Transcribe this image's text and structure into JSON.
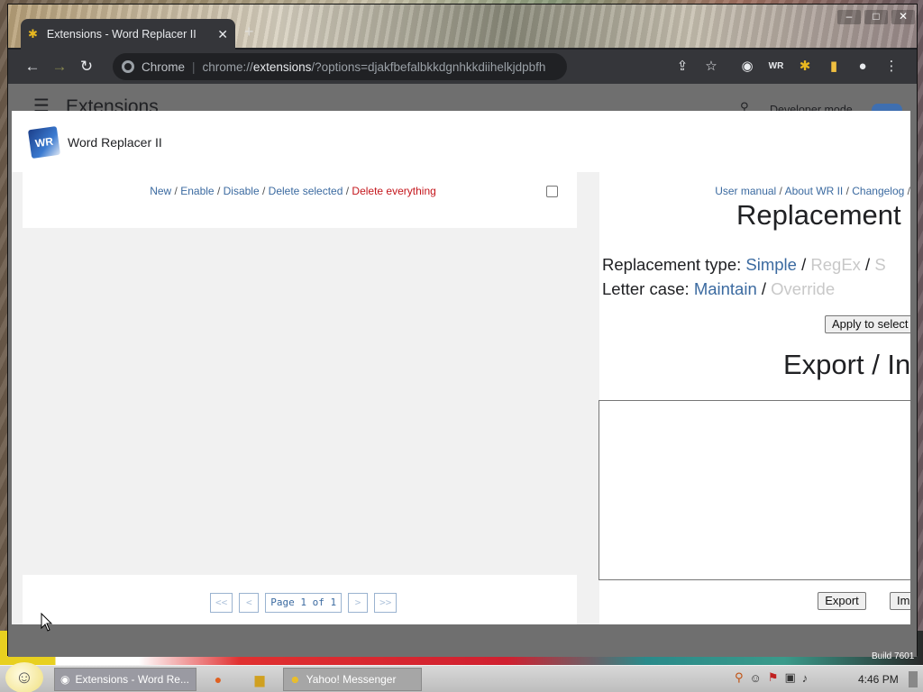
{
  "browser": {
    "tab_title": "Extensions - Word Replacer II",
    "new_tab_label": "+",
    "omnibox": {
      "chip": "Chrome",
      "url_scheme": "chrome://",
      "url_host": "extensions",
      "url_rest": "/?options=djakfbefalbkkdgnhkkdiihelkjdpbfh"
    },
    "window_controls": [
      "–",
      "□",
      "✕"
    ]
  },
  "extensions_page": {
    "title": "Extensions",
    "developer_mode_label": "Developer mode",
    "build_text": "Build 7601"
  },
  "dialog": {
    "extension_name": "Word Replacer II",
    "logo_text": "WR",
    "actions": {
      "new": "New",
      "enable": "Enable",
      "disable": "Disable",
      "delete_selected": "Delete selected",
      "delete_everything": "Delete everything",
      "separator": " / "
    },
    "pager": {
      "first": "<<",
      "prev": "<",
      "page_label": "Page 1 of 1",
      "next": ">",
      "last": ">>"
    },
    "links": {
      "user_manual": "User manual",
      "about": "About WR II",
      "changelog": "Changelog",
      "separator": " / "
    },
    "replacement_heading": "Replacement",
    "replacement_type": {
      "label": "Replacement type: ",
      "simple": "Simple",
      "regex": "RegEx",
      "third": "S"
    },
    "letter_case": {
      "label": "Letter case: ",
      "maintain": "Maintain",
      "override": "Override"
    },
    "apply_button": "Apply to select",
    "export_heading": "Export / In",
    "export_text": "",
    "export_button": "Export",
    "import_button": "Im"
  },
  "taskbar": {
    "chrome_task": "Extensions - Word Re...",
    "yahoo_task": "Yahoo! Messenger",
    "clock": "4:46 PM"
  },
  "colors": {
    "link_blue": "#3b6aa0",
    "danger_red": "#c4161c",
    "disabled_gray": "#c8c8c8",
    "panel_gray": "#f1f1f1"
  }
}
